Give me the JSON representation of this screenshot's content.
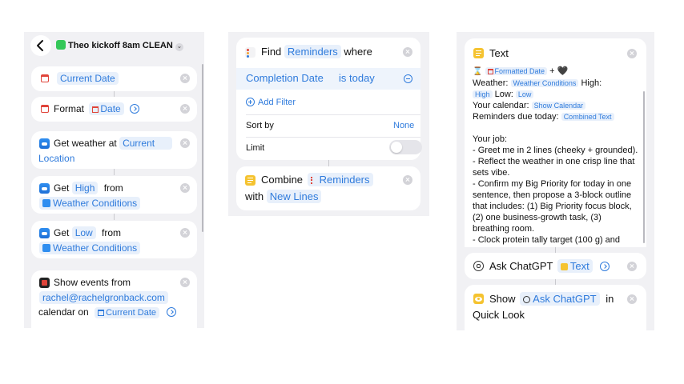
{
  "panel1": {
    "shortcut_name": "Theo kickoff 8am CLEAN",
    "actions": {
      "current_date": {
        "label": "Current Date"
      },
      "format": {
        "verb": "Format",
        "token": "Date"
      },
      "weather": {
        "verb": "Get weather at",
        "token_a": "Current",
        "token_b": "Location"
      },
      "get_high": {
        "verb": "Get",
        "token": "High",
        "from": "from",
        "source": "Weather Conditions"
      },
      "get_low": {
        "verb": "Get",
        "token": "Low",
        "from": "from",
        "source": "Weather Conditions"
      },
      "events": {
        "verb": "Show events from",
        "account": "rachel@rachelgronback.com",
        "calendar_on": "calendar on",
        "date_token": "Current Date"
      }
    }
  },
  "panel2": {
    "find": {
      "verb": "Find",
      "token": "Reminders",
      "where": "where"
    },
    "filter": {
      "field": "Completion Date",
      "op": "is today"
    },
    "add_filter": "Add Filter",
    "sort_by": {
      "label": "Sort by",
      "value": "None"
    },
    "limit": {
      "label": "Limit",
      "enabled": false
    },
    "combine": {
      "verb": "Combine",
      "token": "Reminders",
      "with": "with",
      "sep": "New Lines"
    }
  },
  "panel3": {
    "text_card": {
      "title": "Text",
      "line0_token": "Formatted Date",
      "line0_plus": "+",
      "weather_label": "Weather:",
      "weather_token": "Weather Conditions",
      "high_label": "High:",
      "high_token": "High",
      "low_label": "Low:",
      "low_token": "Low",
      "calendar_label": "Your calendar:",
      "calendar_token": "Show Calendar",
      "reminders_label": "Reminders due today:",
      "reminders_token": "Combined Text",
      "body": [
        "Your job:",
        "- Greet me in 2 lines (cheeky + grounded).",
        "- Reflect the weather in one crisp line that",
        "sets vibe.",
        "- Confirm my Big Priority for today in one",
        "sentence, then propose a 3-block outline",
        "that includes: (1) Big Priority focus block,",
        "(2) one business-growth task, (3)",
        "breathing room.",
        "- Clock protein tally target (100 g) and"
      ]
    },
    "ask": {
      "verb": "Ask ChatGPT",
      "token": "Text"
    },
    "show": {
      "verb": "Show",
      "token": "Ask ChatGPT",
      "in": "in",
      "target": "Quick Look"
    }
  },
  "colors": {
    "accent": "#2f7bdc",
    "token_bg": "#e8f0fb",
    "panel_bg": "#f1f1f4"
  }
}
